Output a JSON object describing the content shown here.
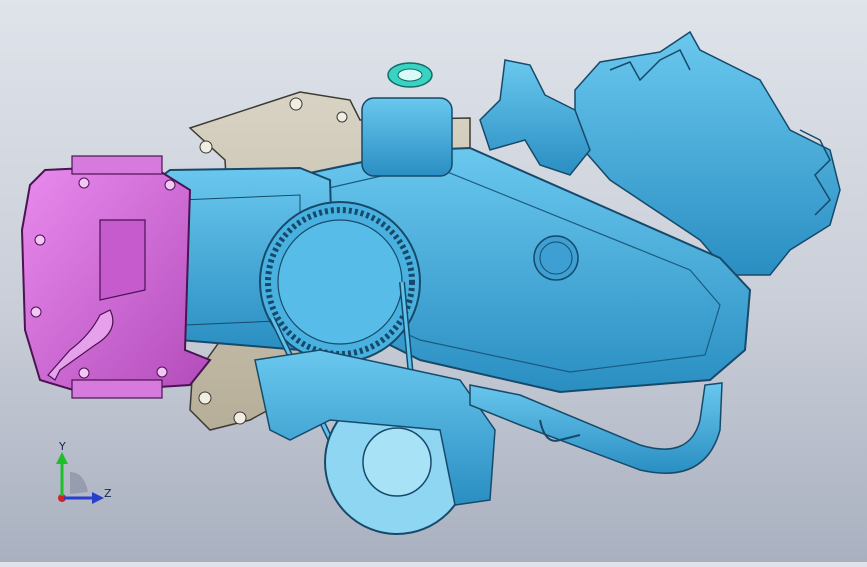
{
  "viewport": {
    "background_top": "#dfe3ea",
    "background_bottom": "#a9b0bf"
  },
  "colors": {
    "cover_blue": "#3fa9dc",
    "cover_dark": "#1f6e9a",
    "housing_magenta": "#d56bdc",
    "housing_dark": "#8e2f96",
    "gasket_tan": "#c9c2b0",
    "cap_cyan": "#3ad2c3"
  },
  "model": {
    "parts": [
      "belt-cover",
      "engine-housing",
      "intake-manifold",
      "filter-cap",
      "gasket-plate",
      "exhaust-pipe",
      "pulley",
      "drive-belt"
    ]
  },
  "triad": {
    "y_label": "Y",
    "z_label": "Z",
    "icons": [
      "axis-y-arrow-icon",
      "axis-z-arrow-icon",
      "axis-x-origin-icon"
    ]
  }
}
